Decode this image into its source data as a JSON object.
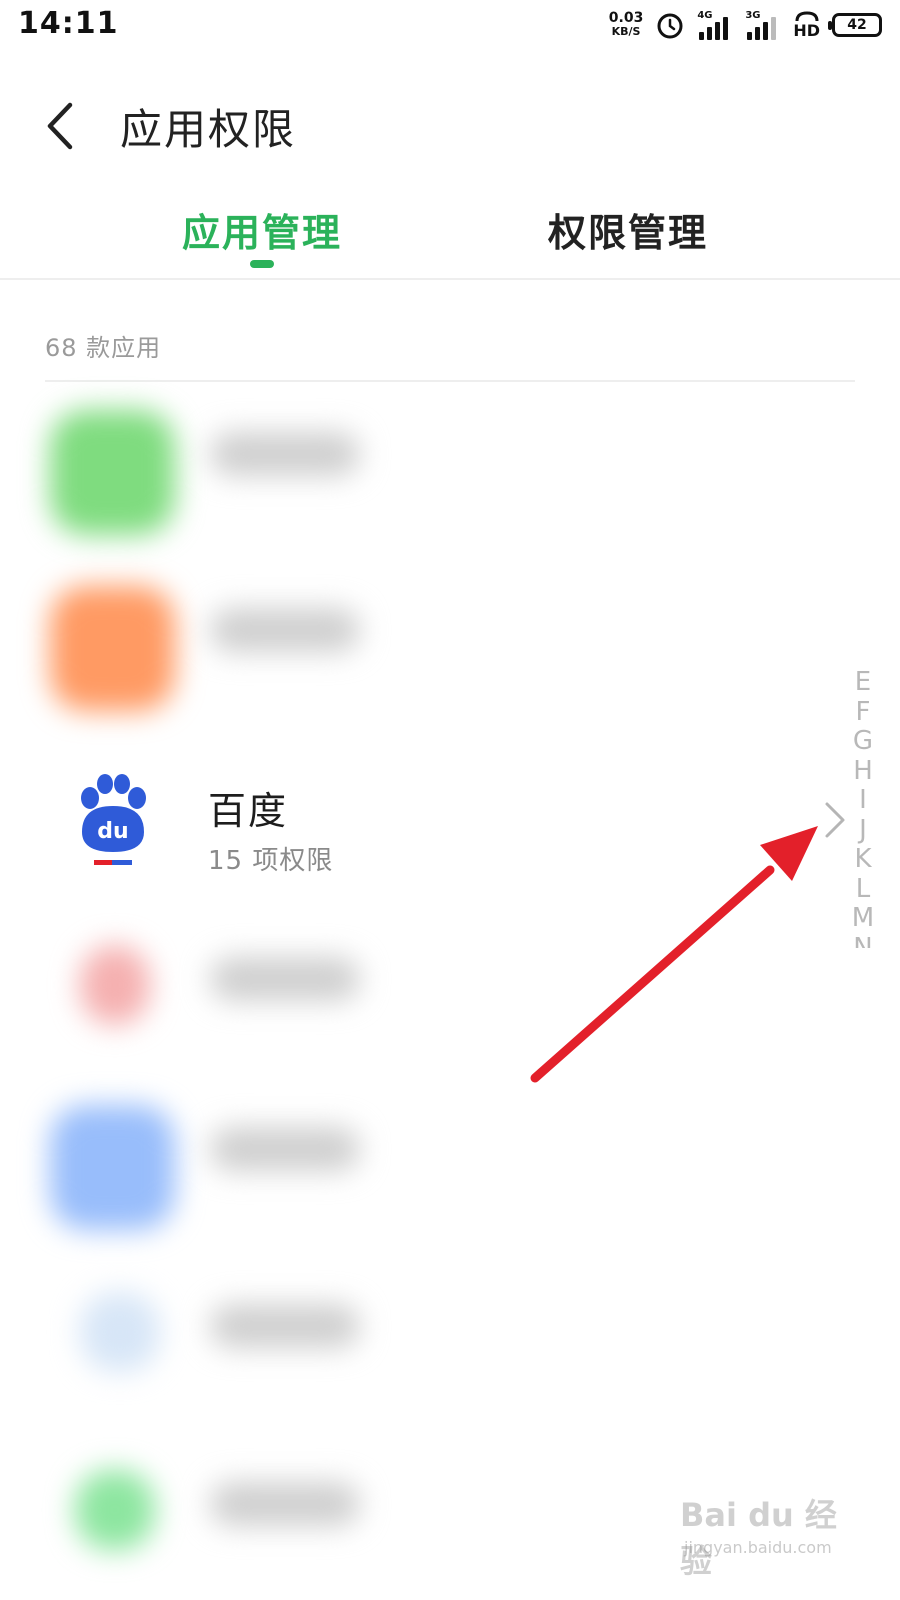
{
  "status_bar": {
    "time": "14:11",
    "net_speed_value": "0.03",
    "net_speed_unit": "KB/S",
    "signal_1_gen": "4G",
    "signal_2_gen": "3G",
    "hd_label": "HD",
    "battery": "42"
  },
  "header": {
    "title": "应用权限",
    "back_icon": "chevron-left-icon"
  },
  "tabs": [
    {
      "label": "应用管理",
      "active": true
    },
    {
      "label": "权限管理",
      "active": false
    }
  ],
  "list": {
    "count_label": "68 款应用",
    "blurred_rows_colors": [
      "#7fdc7f",
      "#ff9a63",
      "#f5b0b0",
      "#98bdfb",
      "#d7e6f7",
      "#8de6a0"
    ],
    "app": {
      "name": "百度",
      "permissions": "15 项权限",
      "icon": "baidu-paw-icon",
      "chevron_icon": "chevron-right-icon"
    }
  },
  "index_bar": [
    "E",
    "F",
    "G",
    "H",
    "I",
    "J",
    "K",
    "L",
    "M",
    "N"
  ],
  "annotation": {
    "type": "red-arrow",
    "color": "#e3202a"
  },
  "watermark": {
    "main": "Bai du 经验",
    "sub": "jingyan.baidu.com"
  },
  "colors": {
    "accent": "#2bb25a",
    "baidu_blue": "#2f5bd8",
    "baidu_red": "#e3202a"
  }
}
